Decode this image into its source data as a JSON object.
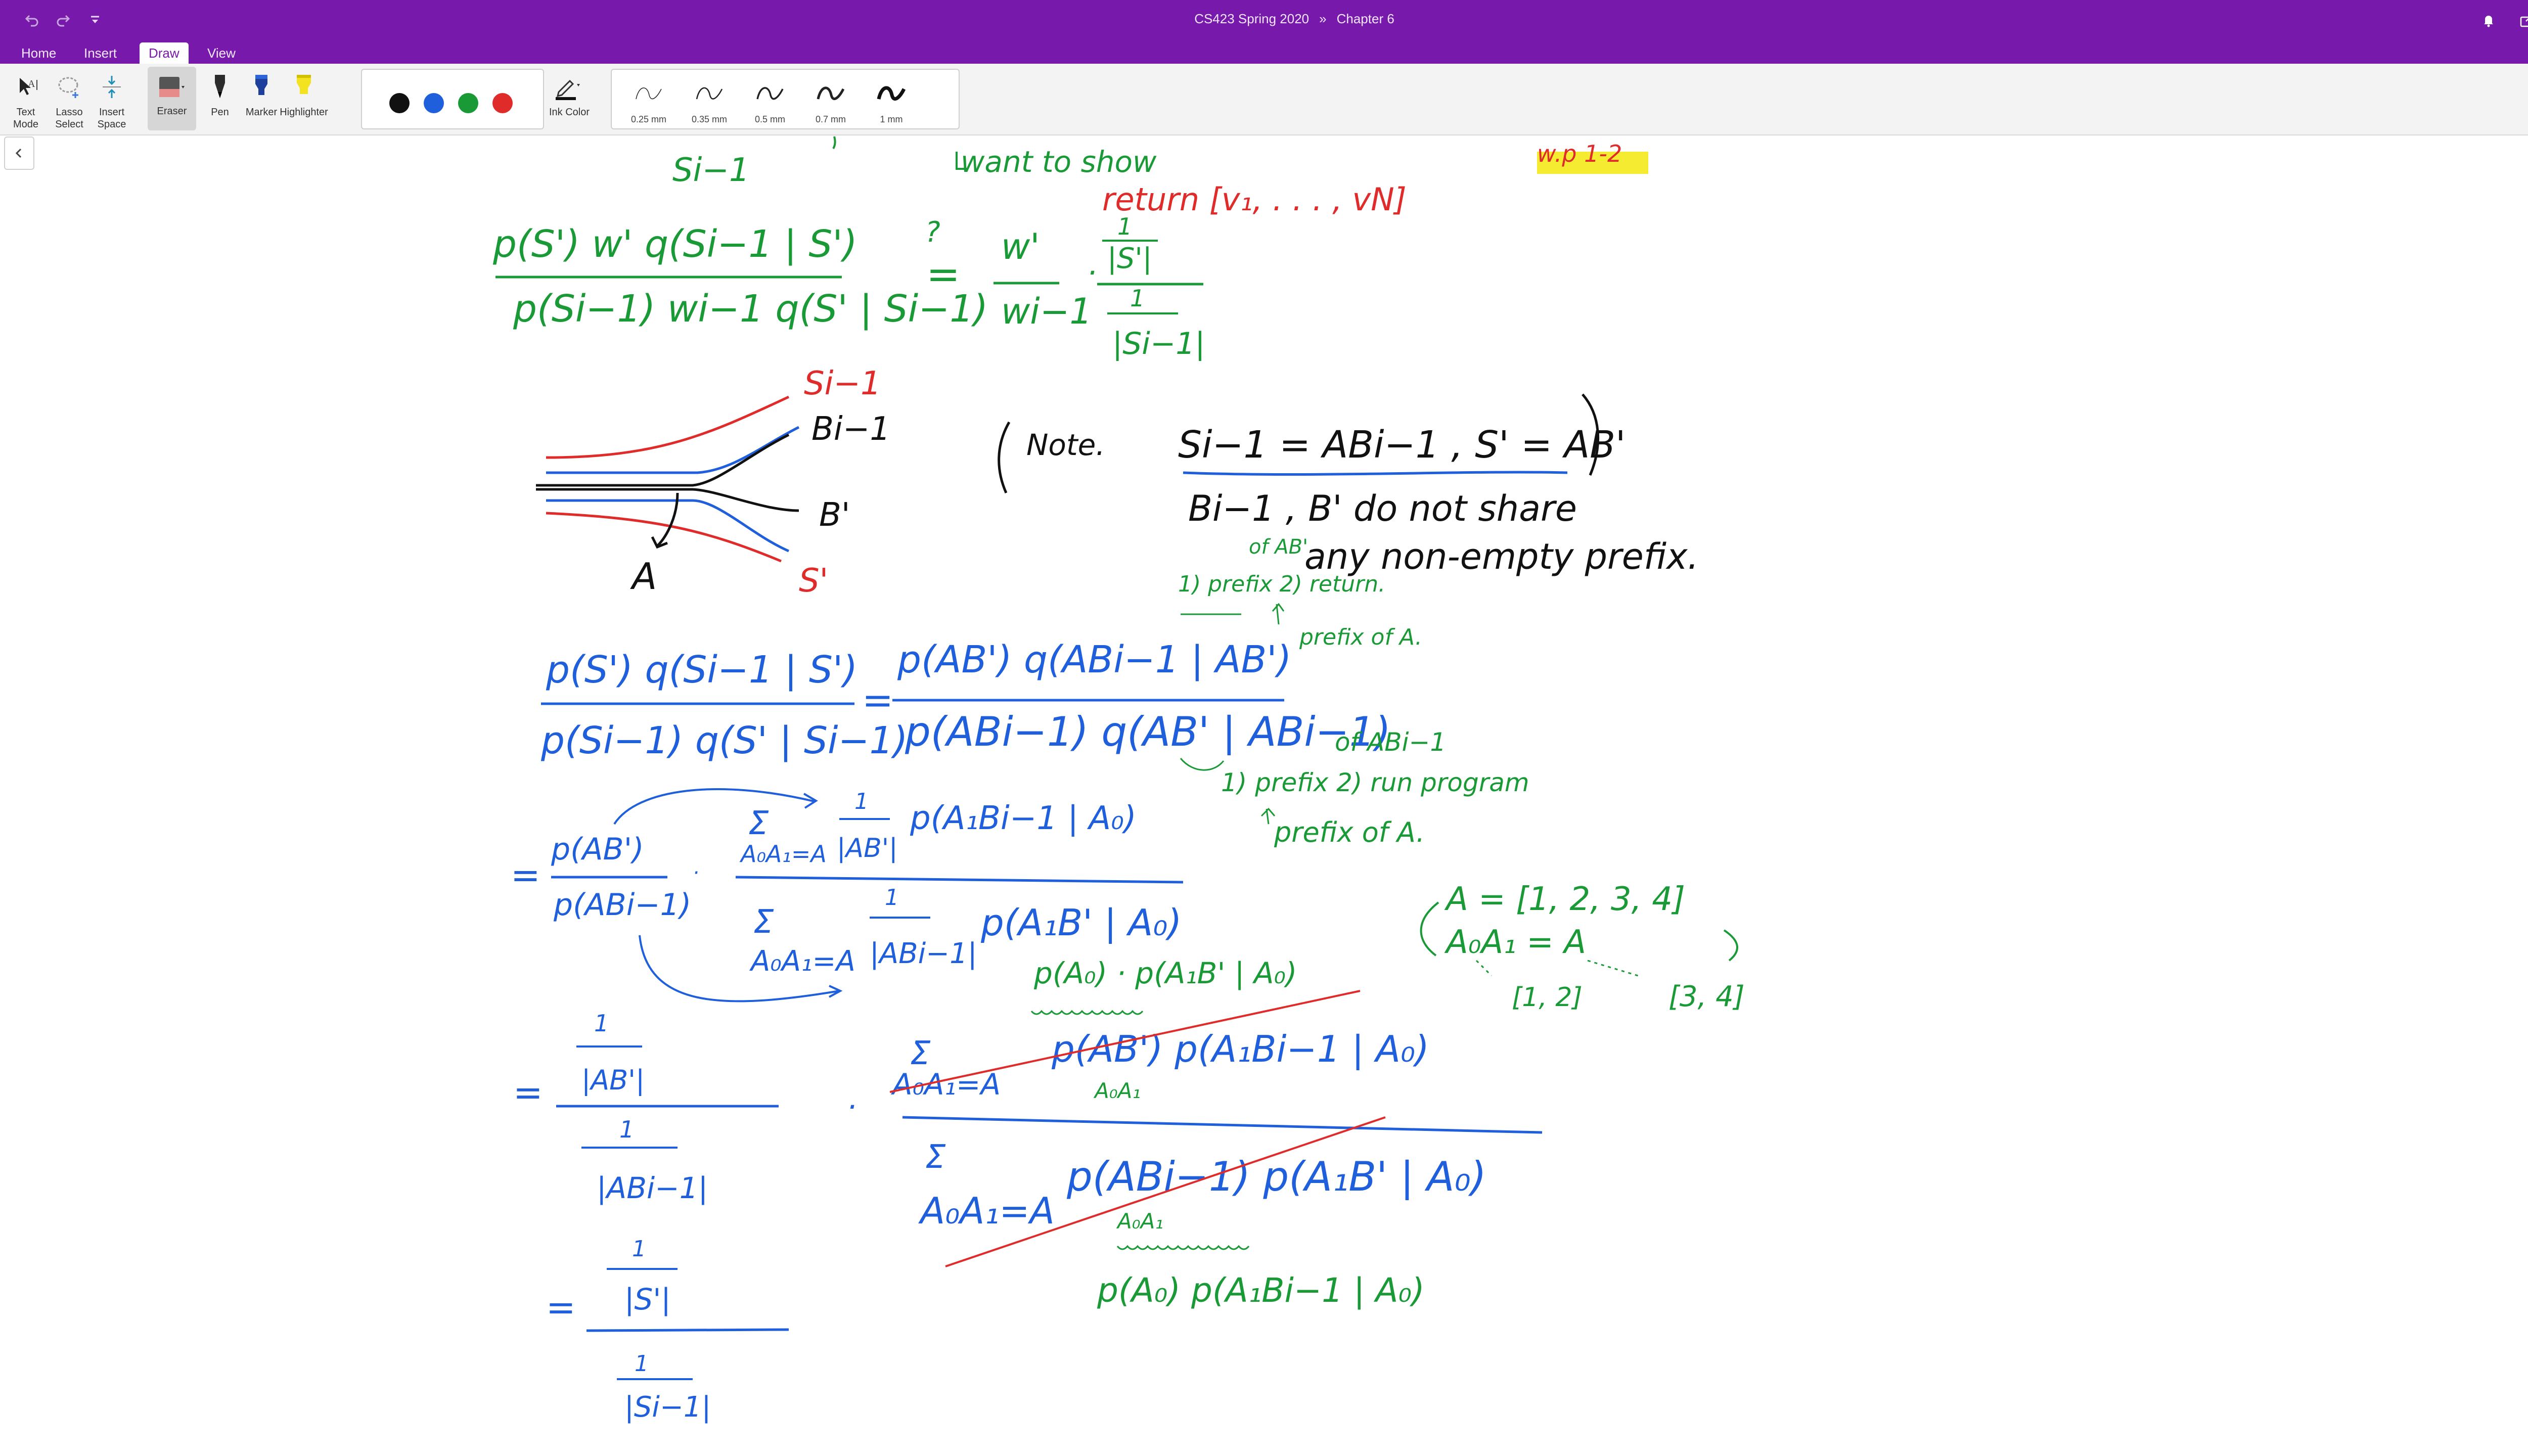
{
  "titlebar": {
    "notebook": "CS423 Spring 2020",
    "separator": "»",
    "section": "Chapter 6",
    "undo_icon": "undo-icon",
    "redo_icon": "redo-icon",
    "customize_icon": "chevron-down-icon",
    "bell_icon": "bell-icon",
    "share_icon": "share-icon",
    "fullscreen_icon": "collapse-icon"
  },
  "tabs": [
    {
      "label": "Home"
    },
    {
      "label": "Insert"
    },
    {
      "label": "Draw",
      "active": true
    },
    {
      "label": "View"
    }
  ],
  "ribbon": {
    "text_mode": "Text Mode",
    "lasso_select": "Lasso Select",
    "insert_space": "Insert Space",
    "eraser": "Eraser",
    "pen": "Pen",
    "marker": "Marker",
    "highlighter": "Highlighter",
    "ink_color": "Ink Color",
    "colors": [
      "#111111",
      "#1f5fdc",
      "#1a9a36",
      "#e02b2b"
    ],
    "thicknesses": [
      "0.25 mm",
      "0.35 mm",
      "0.5 mm",
      "0.7 mm",
      "1 mm"
    ],
    "feedback_icon": "smiley-icon"
  },
  "ink": {
    "top_si": "Si−1",
    "want_to_show": "want to show",
    "return_vn": "return [v₁, . . . , vN]",
    "wp_highlight": "w.p 1-2",
    "eq1_num": "p(S') w' q(Si−1 | S')",
    "eq1_den": "p(Si−1) wi−1 q(S' | Si−1)",
    "eq1_q": "?",
    "eq1_eq": "=",
    "eq1_r_num": "w'",
    "eq1_r_den": "wi−1",
    "eq1_frac_top1": "1",
    "eq1_frac_top2": "|S'|",
    "eq1_frac_bot1": "1",
    "eq1_frac_bot2": "|Si−1|",
    "tree_si": "Si−1",
    "tree_bi": "Bi−1",
    "tree_bp": "B'",
    "tree_sp": "S'",
    "tree_a": "A",
    "note_label": "Note.",
    "note_eq": "Si−1 = ABi−1 ,  S' = AB'",
    "note_line2": "Bi−1 , B' do not share",
    "note_line3": "any non-empty prefix.",
    "note_of_ab": "of AB'",
    "note_sub": "1) prefix  2) return.",
    "note_prefix_a": "prefix of A.",
    "eq2_lhs_num": "p(S') q(Si−1 | S')",
    "eq2_lhs_den": "p(Si−1) q(S' | Si−1)",
    "eq2_eq": "=",
    "eq2_rhs_num": "p(AB') q(ABi−1 | AB')",
    "eq2_rhs_den": "p(ABi−1) q(AB' | ABi−1)",
    "eq2_of_abi": "of ABi−1",
    "eq2_sub": "1) prefix  2) run program",
    "eq2_prefix_a": "prefix of A.",
    "eq3_eq": "=",
    "eq3_num": "p(AB')",
    "eq3_den": "p(ABi−1)",
    "eq3_dot": "·",
    "eq3_sum_top": "Σ",
    "eq3_sum_top_idx": "A₀A₁=A",
    "eq3_top_frac_n": "1",
    "eq3_top_frac_d": "|AB'|",
    "eq3_top_p": "p(A₁Bi−1 | A₀)",
    "eq3_sum_bot": "Σ",
    "eq3_sum_bot_idx": "A₀A₁=A",
    "eq3_bot_frac_n": "1",
    "eq3_bot_frac_d": "|ABi−1|",
    "eq3_bot_p": "p(A₁B' | A₀)",
    "side_a": "A = [1, 2, 3, 4]",
    "side_split": "A₀A₁ = A",
    "side_a0": "[1, 2]",
    "side_a1": "[3, 4]",
    "eq4_green_top": "p(A₀) · p(A₁B' | A₀)",
    "eq4_eq": "=",
    "eq4_n1": "1",
    "eq4_d1": "|AB'|",
    "eq4_n2": "1",
    "eq4_d2": "|ABi−1|",
    "eq4_dot": "·",
    "eq4_sum_top": "Σ",
    "eq4_sum_top_idx": "A₀A₁=A",
    "eq4_top_expr": "p(AB') p(A₁Bi−1 | A₀)",
    "eq4_top_a0a1": "A₀A₁",
    "eq4_sum_bot": "Σ",
    "eq4_sum_bot_idx": "A₀A₁=A",
    "eq4_bot_expr": "p(ABi−1) p(A₁B' | A₀)",
    "eq4_bot_a0a1": "A₀A₁",
    "eq4_green_bot": "p(A₀) p(A₁Bi−1 | A₀)",
    "eq5_eq": "=",
    "eq5_n1": "1",
    "eq5_d1": "|S'|",
    "eq5_n2": "1",
    "eq5_d2": "|Si−1|"
  }
}
